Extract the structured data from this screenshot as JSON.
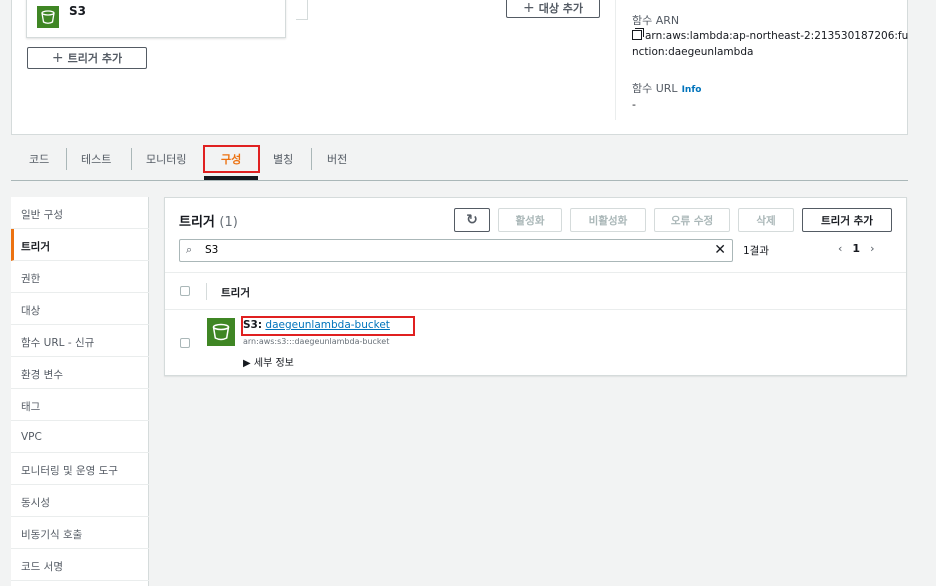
{
  "overview": {
    "trigger_name": "S3",
    "add_trigger_label": "트리거 추가",
    "add_destination_label": "대상 추가",
    "arn_label": "함수 ARN",
    "arn_value": "arn:aws:lambda:ap-northeast-2:213530187206:function:daegeunlambda",
    "url_label": "함수 URL",
    "url_info": "Info",
    "url_value": "-"
  },
  "tabs": [
    "코드",
    "테스트",
    "모니터링",
    "구성",
    "별칭",
    "버전"
  ],
  "active_tab": "구성",
  "sidenav": [
    "일반 구성",
    "트리거",
    "권한",
    "대상",
    "함수 URL - 신규",
    "환경 변수",
    "태그",
    "VPC",
    "모니터링 및 운영 도구",
    "동시성",
    "비동기식 호출",
    "코드 서명"
  ],
  "active_nav": "트리거",
  "panel": {
    "title": "트리거",
    "count": "(1)",
    "buttons": {
      "refresh_icon": "refresh-icon",
      "enable": "활성화",
      "disable": "비활성화",
      "fix_errors": "오류 수정",
      "delete": "삭제",
      "add_trigger": "트리거 추가"
    },
    "search_value": "S3",
    "result_count": "1결과",
    "page": "1",
    "column_header": "트리거",
    "row": {
      "service": "S3",
      "name": "daegeunlambda-bucket",
      "arn": "arn:aws:s3:::daegeunlambda-bucket",
      "details": "세부 정보"
    }
  },
  "colors": {
    "accent": "#ec7211",
    "link": "#0073bb",
    "s3_green": "#3f8624",
    "highlight": "#e02020"
  }
}
